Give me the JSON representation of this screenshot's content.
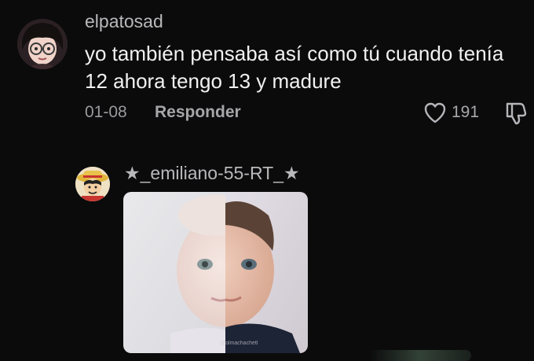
{
  "comments": [
    {
      "username": "elpatosad",
      "text": "yo también pensaba así como tú cuando tenía 12 ahora tengo 13 y madure",
      "date": "01-08",
      "reply_label": "Responder",
      "likes": "191",
      "icons": {
        "like": "heart-outline-icon",
        "dislike": "thumbs-down-outline-icon"
      }
    },
    {
      "username": "★_emiliano-55-RT_★",
      "attachment": {
        "type": "image",
        "watermark": "@olmachachetl"
      }
    }
  ],
  "colors": {
    "background": "#0b0b0c",
    "username": "#b9b9bc",
    "text": "#f1f1f2",
    "meta": "#9a9a9e"
  }
}
